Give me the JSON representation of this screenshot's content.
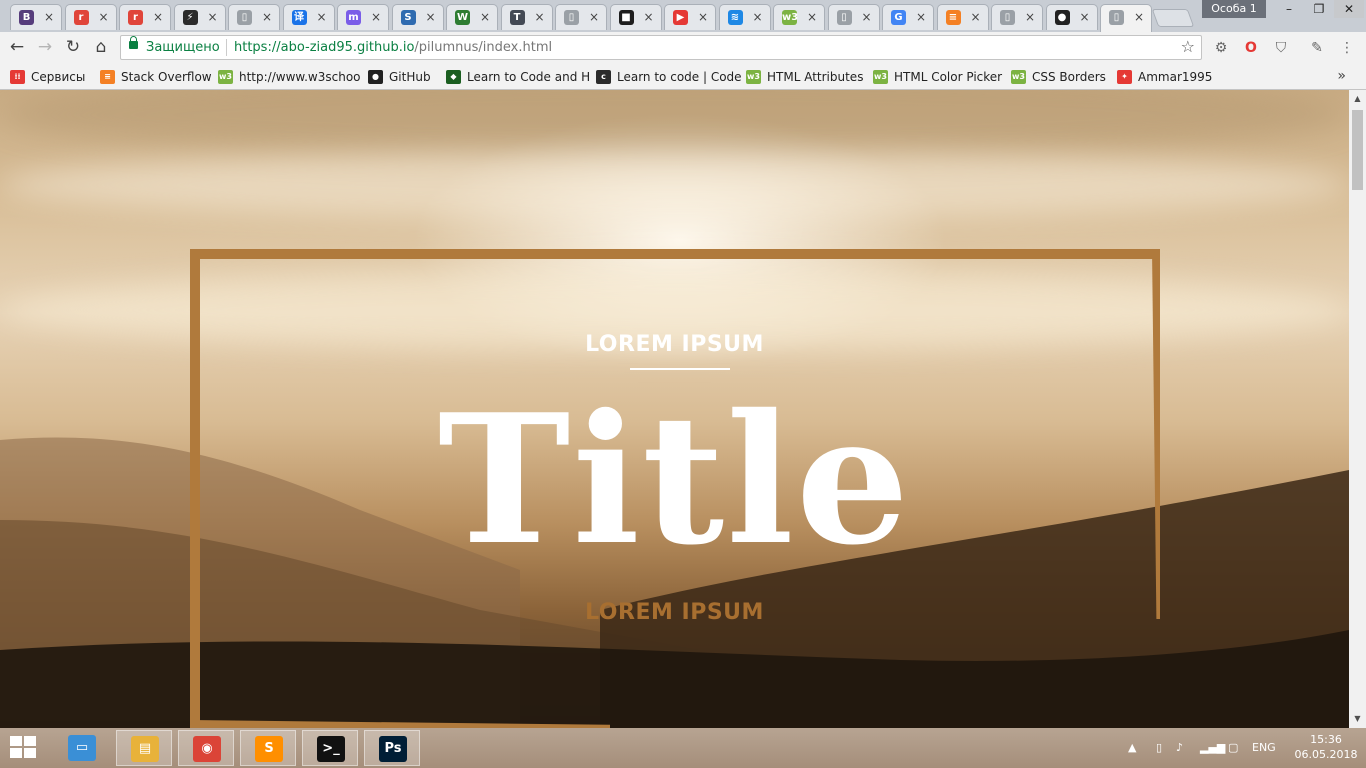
{
  "browser": {
    "tabs": [
      {
        "icon": "bootstrap-icon",
        "glyph": "B",
        "color": "#563d7c"
      },
      {
        "icon": "r-circle-icon",
        "glyph": "r",
        "color": "#e0453a"
      },
      {
        "icon": "r-circle-icon",
        "glyph": "r",
        "color": "#e0453a"
      },
      {
        "icon": "bolt-icon",
        "glyph": "⚡",
        "color": "#2b2b2b"
      },
      {
        "icon": "page-icon",
        "glyph": "▯",
        "color": "#9aa0a6"
      },
      {
        "icon": "translate-icon",
        "glyph": "译",
        "color": "#1a73e8"
      },
      {
        "icon": "mastodon-icon",
        "glyph": "m",
        "color": "#7a5de8"
      },
      {
        "icon": "stackoverflow-icon",
        "glyph": "S",
        "color": "#2f6bb0"
      },
      {
        "icon": "w-icon",
        "glyph": "W",
        "color": "#2e7d32"
      },
      {
        "icon": "t-icon",
        "glyph": "T",
        "color": "#444a55"
      },
      {
        "icon": "page-icon",
        "glyph": "▯",
        "color": "#9aa0a6"
      },
      {
        "icon": "dark-app-icon",
        "glyph": "■",
        "color": "#1e1e1e"
      },
      {
        "icon": "youtube-icon",
        "glyph": "▶",
        "color": "#e53935"
      },
      {
        "icon": "wave-icon",
        "glyph": "≋",
        "color": "#1e88e5"
      },
      {
        "icon": "w3schools-icon",
        "glyph": "w3",
        "color": "#7cb342"
      },
      {
        "icon": "page-icon",
        "glyph": "▯",
        "color": "#9aa0a6"
      },
      {
        "icon": "google-icon",
        "glyph": "G",
        "color": "#4285f4"
      },
      {
        "icon": "stackoverflow-icon",
        "glyph": "≡",
        "color": "#f48024"
      },
      {
        "icon": "page-icon",
        "glyph": "▯",
        "color": "#9aa0a6"
      },
      {
        "icon": "github-icon",
        "glyph": "●",
        "color": "#222222"
      },
      {
        "icon": "page-icon",
        "glyph": "▯",
        "color": "#9aa0a6",
        "active": true
      }
    ],
    "profile": "Особа 1",
    "secure_label": "Защищено",
    "url_host": "https://abo-ziad95.github.io",
    "url_path": "/pilumnus/index.html"
  },
  "bookmarks": [
    {
      "icon": "apps-grid-icon",
      "glyph": "⁞⁞",
      "color": "#e53935",
      "label": "Сервисы"
    },
    {
      "icon": "stackoverflow-icon",
      "glyph": "≡",
      "color": "#f48024",
      "label": "Stack Overflow"
    },
    {
      "icon": "w3schools-icon",
      "glyph": "w3",
      "color": "#7cb342",
      "label": "http://www.w3schoo"
    },
    {
      "icon": "github-icon",
      "glyph": "●",
      "color": "#222222",
      "label": "GitHub"
    },
    {
      "icon": "codecademy-icon",
      "glyph": "◆",
      "color": "#1b5e20",
      "label": "Learn to Code and H"
    },
    {
      "icon": "freecodecamp-icon",
      "glyph": "c",
      "color": "#2b2b2b",
      "label": "Learn to code | Code"
    },
    {
      "icon": "w3schools-icon",
      "glyph": "w3",
      "color": "#7cb342",
      "label": "HTML Attributes"
    },
    {
      "icon": "w3schools-icon",
      "glyph": "w3",
      "color": "#7cb342",
      "label": "HTML Color Picker"
    },
    {
      "icon": "w3schools-icon",
      "glyph": "w3",
      "color": "#7cb342",
      "label": "CSS Borders"
    },
    {
      "icon": "pinwheel-icon",
      "glyph": "✦",
      "color": "#e53935",
      "label": "Ammar1995"
    }
  ],
  "hero": {
    "kicker": "LOREM IPSUM",
    "title": "Title",
    "subtitle": "LOREM IPSUM",
    "frame_color": "#b07a3c"
  },
  "taskbar": {
    "apps": [
      {
        "icon": "file-explorer-icon",
        "glyph": "▭",
        "color": "#3a8fd6"
      },
      {
        "icon": "folder-icon",
        "glyph": "▤",
        "color": "#e8b23a"
      },
      {
        "icon": "chrome-icon",
        "glyph": "◉",
        "color": "#db4437"
      },
      {
        "icon": "sublime-icon",
        "glyph": "S",
        "color": "#ff8f00"
      },
      {
        "icon": "terminal-icon",
        "glyph": ">_",
        "color": "#111111"
      },
      {
        "icon": "photoshop-icon",
        "glyph": "Ps",
        "color": "#001e36"
      }
    ],
    "lang": "ENG",
    "time": "15:36",
    "date": "06.05.2018"
  }
}
